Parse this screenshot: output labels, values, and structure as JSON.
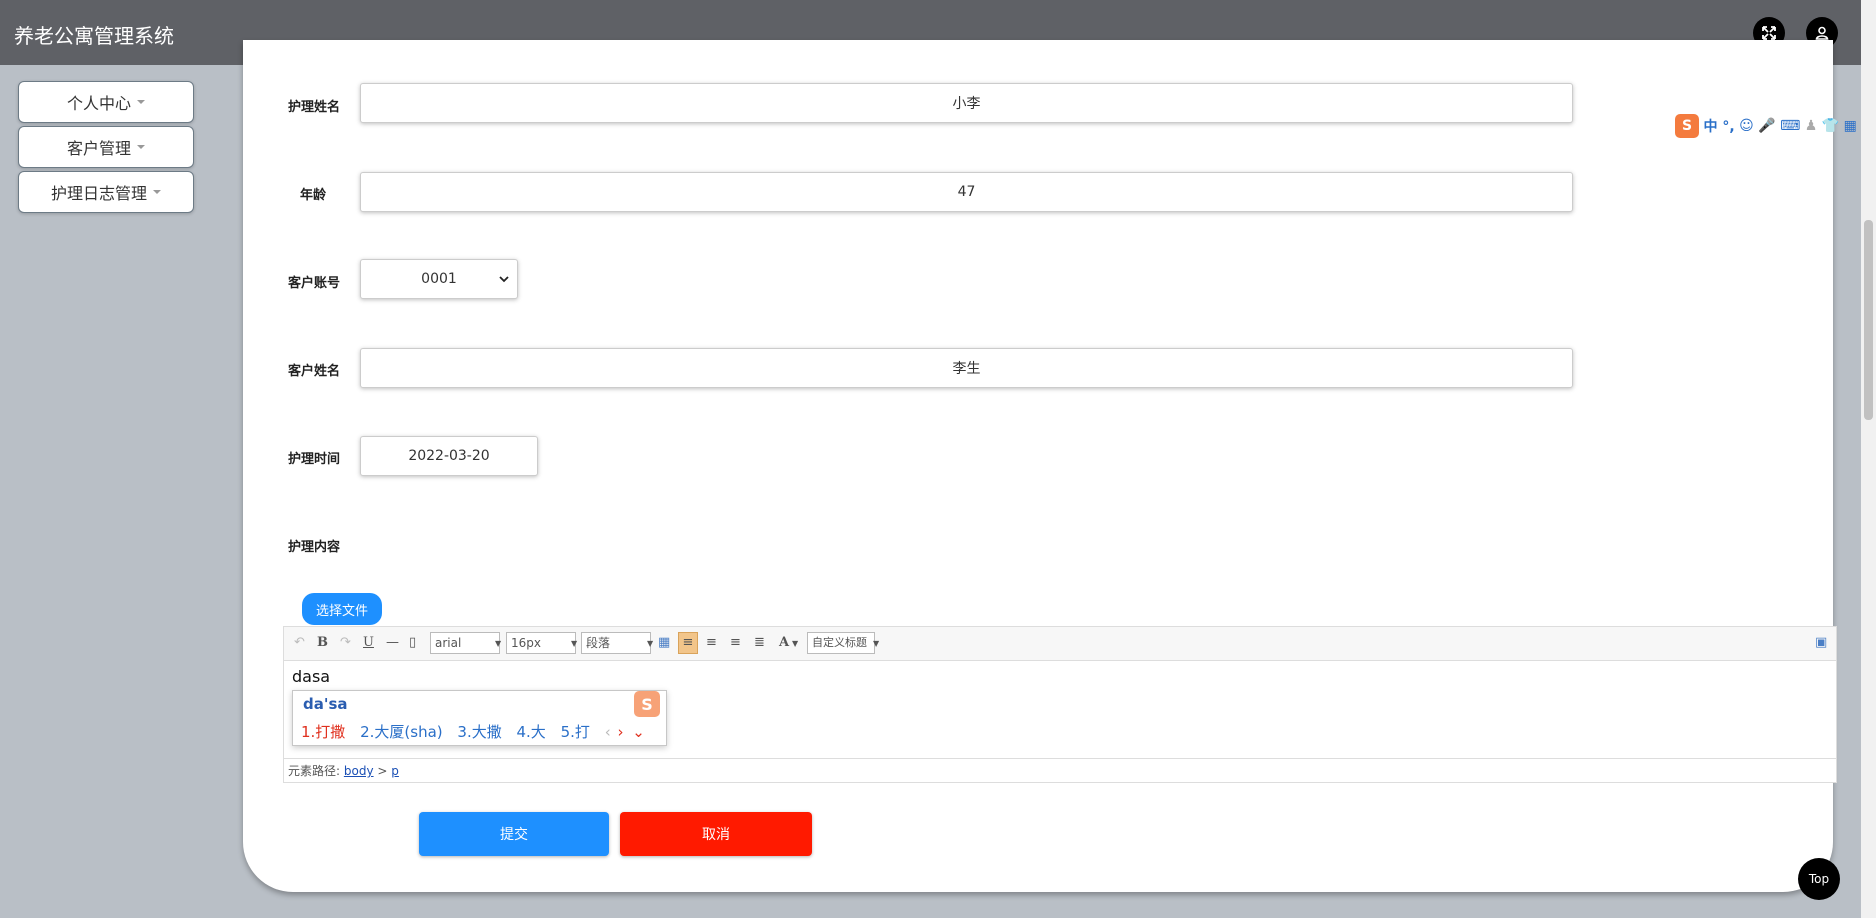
{
  "header": {
    "title": "养老公寓管理系统",
    "icons": [
      "fullscreen-icon",
      "user-icon"
    ]
  },
  "sidebar": {
    "items": [
      {
        "label": "个人中心"
      },
      {
        "label": "客户管理"
      },
      {
        "label": "护理日志管理"
      }
    ]
  },
  "form": {
    "nurse_name": {
      "label": "护理姓名",
      "value": "小李"
    },
    "age": {
      "label": "年龄",
      "value": "47"
    },
    "customer_account": {
      "label": "客户账号",
      "value": "0001"
    },
    "customer_name": {
      "label": "客户姓名",
      "value": "李生"
    },
    "care_time": {
      "label": "护理时间",
      "value": "2022-03-20"
    },
    "care_content": {
      "label": "护理内容"
    }
  },
  "editor": {
    "choose_file": "选择文件",
    "toolbar": {
      "font": "arial",
      "size": "16px",
      "paragraph": "段落",
      "custom_title": "自定义标题",
      "bold": "B",
      "underline": "U",
      "font_color": "A"
    },
    "content": "dasa",
    "status_label": "元素路径:",
    "path_body": "body",
    "path_sep": ">",
    "path_p": "p"
  },
  "ime": {
    "composition": "da'sa",
    "candidates": [
      "1.打撒",
      "2.大厦(sha)",
      "3.大撒",
      "4.大",
      "5.打"
    ],
    "status": "中 °,"
  },
  "buttons": {
    "submit": "提交",
    "cancel": "取消",
    "top": "Top"
  },
  "colors": {
    "header": "#5f6166",
    "primary": "#1e90ff",
    "danger": "#ff1a00"
  }
}
